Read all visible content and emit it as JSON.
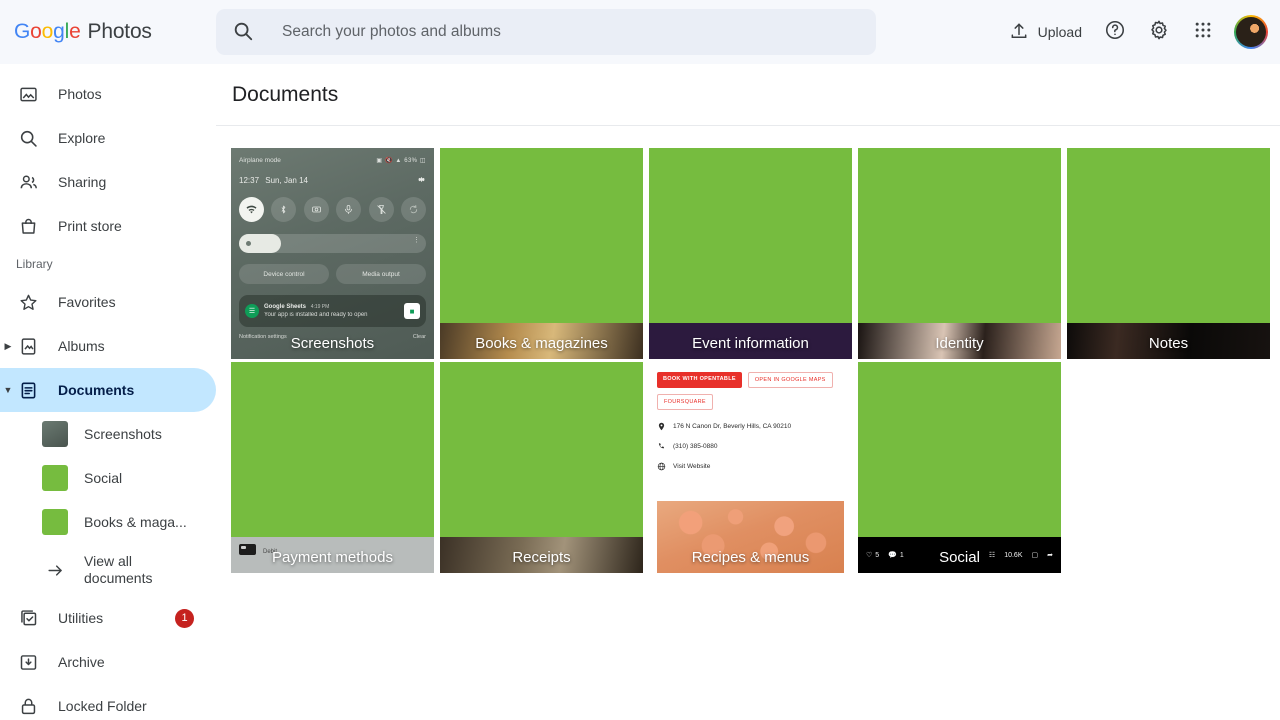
{
  "header": {
    "brand": {
      "google": "Google",
      "product": "Photos"
    },
    "search": {
      "placeholder": "Search your photos and albums",
      "icon": "search-icon"
    },
    "upload_label": "Upload",
    "upload_icon": "upload-icon",
    "help_icon": "help-circle-icon",
    "settings_icon": "gear-icon",
    "apps_icon": "apps-grid-icon",
    "avatar_icon": "avatar"
  },
  "sidebar": {
    "primary": [
      {
        "label": "Photos",
        "icon": "photo-icon",
        "selected": false
      },
      {
        "label": "Explore",
        "icon": "search-icon",
        "selected": false
      },
      {
        "label": "Sharing",
        "icon": "people-icon",
        "selected": false
      },
      {
        "label": "Print store",
        "icon": "shopping-bag-icon",
        "selected": false
      }
    ],
    "section_label": "Library",
    "library": [
      {
        "label": "Favorites",
        "icon": "star-icon",
        "selected": false,
        "expandable": false
      },
      {
        "label": "Albums",
        "icon": "album-icon",
        "selected": false,
        "expandable": true
      },
      {
        "label": "Documents",
        "icon": "document-icon",
        "selected": true,
        "expandable": true
      }
    ],
    "document_children": [
      {
        "label": "Screenshots",
        "thumb": "screenshot-thumb"
      },
      {
        "label": "Social",
        "thumb": "green-thumb"
      },
      {
        "label": "Books & maga...",
        "thumb": "green-thumb"
      }
    ],
    "view_all": {
      "label": "View all documents",
      "icon": "arrow-right-icon"
    },
    "bottom": [
      {
        "label": "Utilities",
        "icon": "utilities-icon",
        "badge": "1"
      },
      {
        "label": "Archive",
        "icon": "archive-icon",
        "badge": ""
      },
      {
        "label": "Locked Folder",
        "icon": "lock-icon",
        "badge": ""
      }
    ]
  },
  "main": {
    "page_title": "Documents",
    "tiles": [
      {
        "caption": "Screenshots",
        "kind": "screenshot"
      },
      {
        "caption": "Books & magazines",
        "kind": "strip-books"
      },
      {
        "caption": "Event information",
        "kind": "strip-event"
      },
      {
        "caption": "Identity",
        "kind": "strip-identity"
      },
      {
        "caption": "Notes",
        "kind": "strip-notes"
      },
      {
        "caption": "Payment methods",
        "kind": "strip-payment"
      },
      {
        "caption": "Receipts",
        "kind": "strip-receipts"
      },
      {
        "caption": "Recipes & menus",
        "kind": "recipe"
      },
      {
        "caption": "Social",
        "kind": "strip-social"
      }
    ]
  },
  "screenshot_tile": {
    "status_left": "Airplane mode",
    "status_right": "63%",
    "time": "12:37",
    "date": "Sun, Jan 14",
    "settings_icon": "gear-icon",
    "toggles": [
      {
        "name": "wifi-toggle",
        "glyph": "▾",
        "on": true
      },
      {
        "name": "bluetooth-toggle",
        "glyph": "ᛦ",
        "on": false
      },
      {
        "name": "camera-toggle",
        "glyph": "▣",
        "on": false
      },
      {
        "name": "microphone-toggle",
        "glyph": "⌇",
        "on": false
      },
      {
        "name": "flashlight-toggle",
        "glyph": "✕",
        "on": false
      },
      {
        "name": "auto-rotate-toggle",
        "glyph": "↻",
        "on": false
      }
    ],
    "buttons": [
      "Device control",
      "Media output"
    ],
    "notification": {
      "app": "Google Sheets",
      "time": "4:19 PM",
      "body": "Your app is installed and ready to open"
    },
    "footer_left": "Notification settings",
    "footer_right": "Clear"
  },
  "recipe_tile": {
    "buttons": [
      "BOOK WITH OPENTABLE",
      "OPEN IN GOOGLE MAPS",
      "FOURSQUARE"
    ],
    "address": "176 N Canon Dr, Beverly Hills, CA 90210",
    "phone": "(310) 385-0880",
    "website": "Visit Website",
    "address_icon": "location-pin-icon",
    "phone_icon": "phone-icon",
    "website_icon": "globe-icon"
  },
  "social_tile": {
    "like_count": "5",
    "comment_count": "1",
    "views": "10.6K",
    "like_icon": "heart-icon",
    "comment_icon": "comment-icon",
    "views_icon": "chart-icon",
    "bookmark_icon": "bookmark-icon",
    "share_icon": "share-icon"
  },
  "payment_tile": {
    "label": "Debit"
  },
  "colors": {
    "green_placeholder": "#76bc3f",
    "selected_nav": "#c2e7ff",
    "header_bg": "#f6f8fc",
    "search_bg": "#eaeef6",
    "badge_red": "#c5221f",
    "event_purple": "#2c1a3e"
  }
}
